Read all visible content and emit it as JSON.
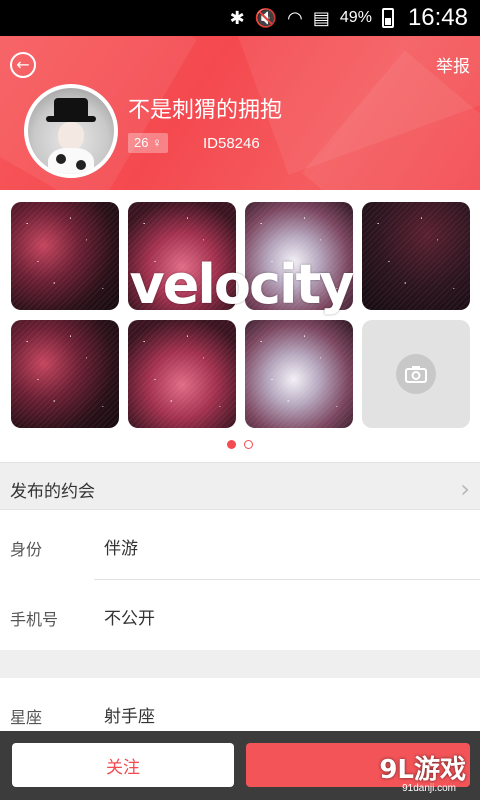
{
  "status_bar": {
    "icons": [
      "bluetooth-icon",
      "mute-icon",
      "wifi-icon",
      "sim-icon",
      "battery-icon"
    ],
    "battery_percent": "49%",
    "time": "16:48"
  },
  "header": {
    "report_label": "举报",
    "nickname": "不是刺猬的拥抱",
    "badge_text": "26 ♀",
    "user_id": "ID58246",
    "background_color": "#f44b52"
  },
  "gallery": {
    "banner_text": "velocity",
    "page_count": 2,
    "active_page": 1
  },
  "posted_dates": {
    "label": "发布的约会"
  },
  "profile": {
    "fields": [
      {
        "key": "身份",
        "value": "伴游"
      },
      {
        "key": "手机号",
        "value": "不公开"
      },
      {
        "key": "星座",
        "value": "射手座"
      }
    ]
  },
  "actions": {
    "follow_label": "关注"
  },
  "watermark": {
    "logo_text": "9L游戏",
    "site_text": "91danji.com"
  },
  "colors": {
    "accent": "#f44b52",
    "bottom_bar": "#3c3c3c"
  }
}
